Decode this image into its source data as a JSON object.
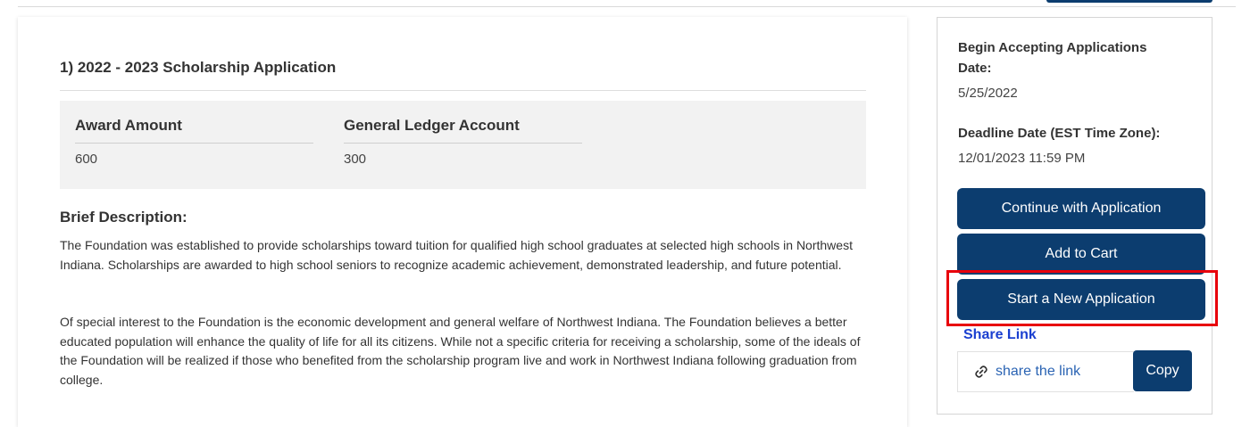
{
  "application": {
    "title": "1) 2022 - 2023 Scholarship Application",
    "award_amount_label": "Award Amount",
    "award_amount_value": "600",
    "ledger_label": "General Ledger Account",
    "ledger_value": "300"
  },
  "description": {
    "heading": "Brief Description:",
    "paragraph1": "The Foundation was established to provide scholarships toward tuition for qualified high school graduates at selected high schools in Northwest Indiana. Scholarships are awarded to high school seniors to recognize academic achievement, demonstrated leadership, and future potential.",
    "paragraph2": "Of special interest to the Foundation is the economic development and general welfare of Northwest Indiana. The Foundation believes a better educated population will enhance the quality of life for all its citizens. While not a specific criteria for receiving a scholarship, some of the ideals of the Foundation will be realized if those who benefited from the scholarship program live and work in Northwest Indiana following graduation from college."
  },
  "sidebar": {
    "begin_label": "Begin Accepting Applications Date:",
    "begin_value": "5/25/2022",
    "deadline_label": "Deadline Date (EST Time Zone):",
    "deadline_value": "12/01/2023 11:59 PM",
    "continue_button": "Continue with Application",
    "cart_button": "Add to Cart",
    "new_app_button": "Start a New Application",
    "share_label": "Share Link",
    "share_link_text": "share the link",
    "copy_button": "Copy"
  },
  "colors": {
    "primary_button": "#0c3d6f",
    "highlight_border": "#e8000b",
    "share_label": "#1a3fd0",
    "link": "#2a63b3"
  },
  "icons": {
    "share": "link-icon"
  }
}
